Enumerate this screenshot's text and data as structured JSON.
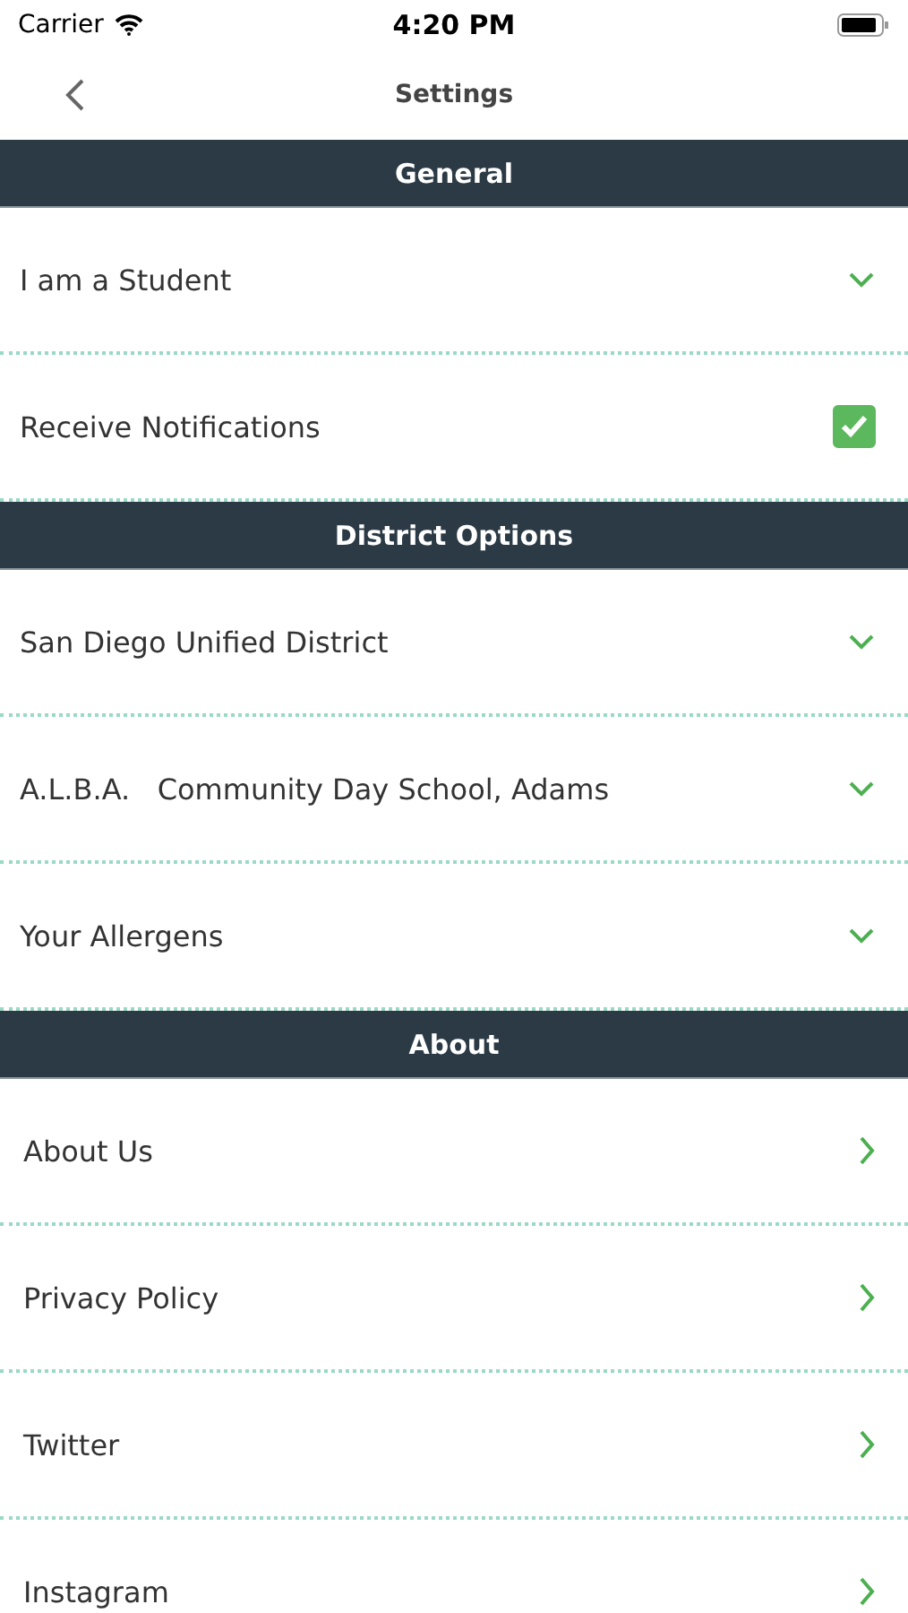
{
  "status_bar": {
    "carrier": "Carrier",
    "time": "4:20 PM"
  },
  "nav": {
    "title": "Settings"
  },
  "sections": [
    {
      "title": "General",
      "rows": [
        {
          "kind": "dropdown",
          "label": "I am a Student"
        },
        {
          "kind": "checkbox",
          "label": "Receive Notifications",
          "checked": true
        }
      ]
    },
    {
      "title": "District Options",
      "rows": [
        {
          "kind": "dropdown",
          "label": "San Diego Unified District"
        },
        {
          "kind": "dropdown",
          "label": "A.L.B.A.   Community Day School, Adams"
        },
        {
          "kind": "dropdown",
          "label": "Your Allergens"
        }
      ]
    },
    {
      "title": "About",
      "rows": [
        {
          "kind": "link",
          "label": "About Us"
        },
        {
          "kind": "link",
          "label": "Privacy Policy"
        },
        {
          "kind": "link",
          "label": "Twitter"
        },
        {
          "kind": "link",
          "label": "Instagram"
        }
      ]
    }
  ]
}
